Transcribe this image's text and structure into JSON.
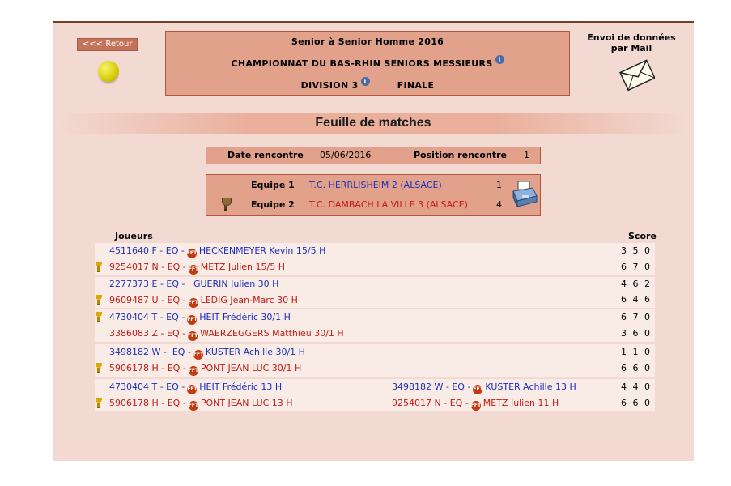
{
  "header": {
    "retour_label": "<<< Retour",
    "title_line1": "Senior à Senior Homme 2016",
    "title_line2": "CHAMPIONNAT DU BAS-RHIN SENIORS MESSIEURS",
    "title_line3_division": "DIVISION 3",
    "title_line3_phase": "FINALE",
    "mail_title_1": "Envoi de données",
    "mail_title_2": "par Mail"
  },
  "banner": {
    "title": "Feuille de matches"
  },
  "rencontre": {
    "date_label": "Date rencontre",
    "date_value": "05/06/2016",
    "position_label": "Position rencontre",
    "position_value": "1"
  },
  "equipes": [
    {
      "label": "Equipe 1",
      "name": "T.C. HERRLISHEIM 2 (ALSACE)",
      "score": "1"
    },
    {
      "label": "Equipe 2",
      "name": "T.C. DAMBACH LA VILLE 3 (ALSACE)",
      "score": "4"
    }
  ],
  "columns": {
    "joueurs": "Joueurs",
    "score": "Score"
  },
  "matches": [
    {
      "p1": {
        "id": "4511640 F -",
        "eq": "EQ -",
        "name": "HECKENMEYER Kevin 15/5 H"
      },
      "p2": {
        "id": "9254017 N -",
        "eq": "EQ -",
        "name": "METZ Julien 15/5 H"
      },
      "s1": "3 5 0",
      "s2": "6 7 0"
    },
    {
      "p1": {
        "id": "2277373 E -",
        "eq": "EQ -",
        "name": "GUERIN Julien 30 H"
      },
      "p2": {
        "id": "9609487 U -",
        "eq": "EQ -",
        "name": "LEDIG Jean-Marc 30 H"
      },
      "s1": "4 6 2",
      "s2": "6 4 6"
    },
    {
      "p1": {
        "id": "4730404 T -",
        "eq": "EQ -",
        "name": "HEIT Frédéric 30/1 H"
      },
      "p2": {
        "id": "3386083 Z -",
        "eq": "EQ -",
        "name": "WAERZEGGERS Matthieu 30/1 H"
      },
      "s1": "6 7 0",
      "s2": "3 6 0"
    },
    {
      "p1": {
        "id": "3498182 W -",
        "eq": "EQ -",
        "name": "KUSTER Achille 30/1 H"
      },
      "p2": {
        "id": "5906178 H -",
        "eq": "EQ -",
        "name": "PONT JEAN LUC 30/1 H"
      },
      "s1": "1 1 0",
      "s2": "6 6 0"
    },
    {
      "p1": {
        "id": "4730404 T -",
        "eq": "EQ -",
        "name": "HEIT Frédéric 13 H"
      },
      "p1b": {
        "id": "3498182 W -",
        "eq": "EQ -",
        "name": "KUSTER Achille 13 H"
      },
      "p2": {
        "id": "5906178 H -",
        "eq": "EQ -",
        "name": "PONT JEAN LUC 13 H"
      },
      "p2b": {
        "id": "9254017 N -",
        "eq": "EQ -",
        "name": "METZ Julien 11 H"
      },
      "s1": "4 4 0",
      "s2": "6 6 0"
    }
  ],
  "colors": {
    "frame": "#f2d9d1",
    "box": "#e2a18a",
    "border": "#b0573c",
    "blue": "#1c2fb8",
    "red": "#c41a12"
  }
}
